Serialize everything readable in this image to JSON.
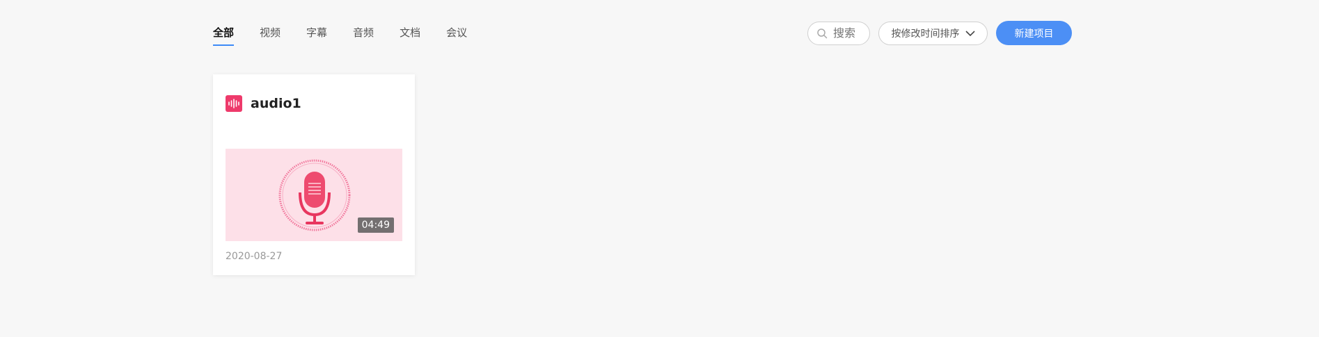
{
  "tabs": [
    {
      "label": "全部",
      "active": true
    },
    {
      "label": "视频",
      "active": false
    },
    {
      "label": "字幕",
      "active": false
    },
    {
      "label": "音频",
      "active": false
    },
    {
      "label": "文档",
      "active": false
    },
    {
      "label": "会议",
      "active": false
    }
  ],
  "toolbar": {
    "search_placeholder": "搜索",
    "sort_label": "按修改时间排序",
    "new_project_label": "新建项目"
  },
  "card": {
    "title": "audio1",
    "duration": "04:49",
    "date": "2020-08-27",
    "type_icon": "audio-wave-icon"
  },
  "colors": {
    "accent": "#4c8ff5",
    "tab_underline": "#3d8af7",
    "audio_badge": "#ee3a6b",
    "thumb_bg": "#fde0e8",
    "mic": "#ee4b6f"
  }
}
